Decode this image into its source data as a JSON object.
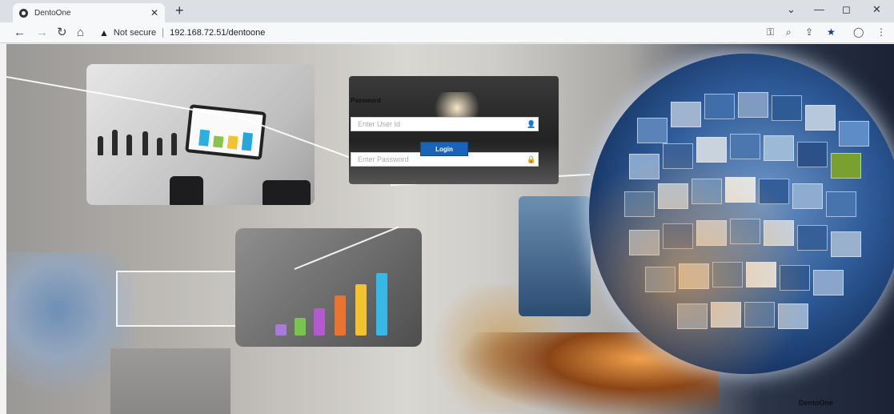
{
  "browser": {
    "tab_title": "DentoOne",
    "tab_close": "✕",
    "new_tab": "+",
    "security_label": "Not secure",
    "url": "192.168.72.51/dentoone",
    "controls": {
      "minimize": "—",
      "maximize": "◻",
      "close": "✕",
      "tab_list": "⌄"
    }
  },
  "login": {
    "user_placeholder": "Enter User Id",
    "password_label": "Password",
    "password_placeholder": "Enter Password",
    "login_button": "Login"
  },
  "footer": {
    "brand": "DentoOne"
  },
  "icons": [
    "globe-icon",
    "back-arrow-icon",
    "forward-arrow-icon",
    "reload-icon",
    "home-icon",
    "warning-icon",
    "key-icon",
    "zoom-icon",
    "share-icon",
    "star-icon",
    "profile-icon",
    "menu-icon",
    "user-icon",
    "lock-icon"
  ],
  "colors": {
    "login_button": "#1a63b9",
    "tab_bar": "#dcdfe3"
  }
}
